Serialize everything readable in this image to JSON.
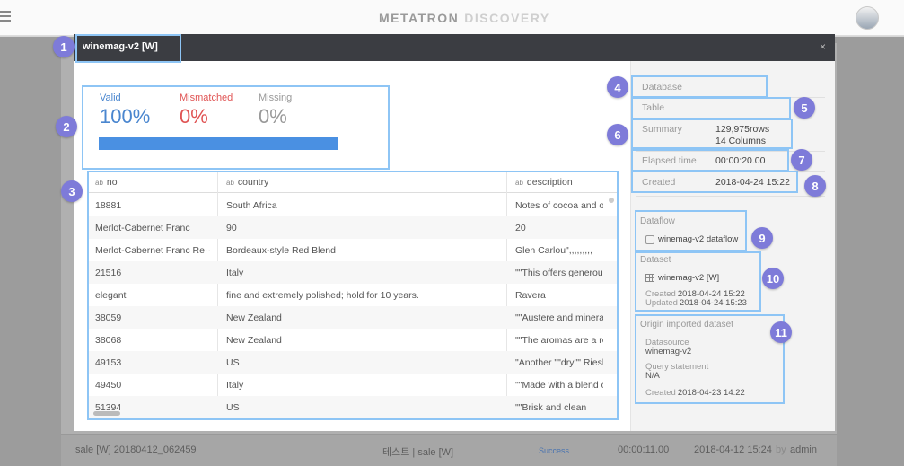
{
  "app": {
    "brand_main": "METATRON",
    "brand_sub": "DISCOVERY"
  },
  "modal": {
    "title": "winemag-v2 [W]",
    "close_label": "×"
  },
  "stats": {
    "valid_label": "Valid",
    "valid_value": "100%",
    "mismatched_label": "Mismatched",
    "mismatched_value": "0%",
    "missing_label": "Missing",
    "missing_value": "0%",
    "valid_fraction": 1.0
  },
  "table": {
    "type_tag": "ab",
    "columns": [
      "no",
      "country",
      "description"
    ],
    "rows": [
      [
        "18881",
        "South Africa",
        "Notes of cocoa and oal"
      ],
      [
        "Merlot-Cabernet Franc",
        "90",
        "20"
      ],
      [
        "Merlot-Cabernet Franc Re···",
        "Bordeaux-style Red Blend",
        "Glen Carlou\",,,,,,,,,"
      ],
      [
        "21516",
        "Italy",
        "\"\"This offers generous"
      ],
      [
        "elegant",
        "fine and extremely polished; hold for 10 years.",
        "Ravera"
      ],
      [
        "38059",
        "New Zealand",
        "\"\"Austere and minerall"
      ],
      [
        "38068",
        "New Zealand",
        "\"\"The aromas are a ref"
      ],
      [
        "49153",
        "US",
        "\"Another \"\"dry\"\" Riesli"
      ],
      [
        "49450",
        "Italy",
        "\"\"Made with a blend of"
      ],
      [
        "51394",
        "US",
        "\"\"Brisk and clean"
      ]
    ]
  },
  "side": {
    "database_label": "Database",
    "table_label": "Table",
    "summary_label": "Summary",
    "summary_rows": "129,975rows",
    "summary_cols": "14 Columns",
    "elapsed_label": "Elapsed time",
    "elapsed_value": "00:00:20.00",
    "created_label": "Created",
    "created_value": "2018-04-24 15:22",
    "dataflow_title": "Dataflow",
    "dataflow_name": "winemag-v2 dataflow",
    "dataset_title": "Dataset",
    "dataset_name": "winemag-v2 [W]",
    "dataset_created_label": "Created",
    "dataset_created_value": "2018-04-24 15:22",
    "dataset_updated_label": "Updated",
    "dataset_updated_value": "2018-04-24 15:23",
    "origin_title": "Origin imported dataset",
    "datasource_label": "Datasource",
    "datasource_value": "winemag-v2",
    "query_label": "Query statement",
    "query_value": "N/A",
    "origin_created_label": "Created",
    "origin_created_value": "2018-04-23 14:22"
  },
  "footer_row": {
    "name": "sale [W] 20180412_062459",
    "dataflow": "테스트 | sale [W]",
    "status": "Success",
    "elapsed": "00:00:11.00",
    "date": "2018-04-12 15:24",
    "by": "by",
    "user": "admin"
  },
  "badges": [
    "1",
    "2",
    "3",
    "4",
    "5",
    "6",
    "7",
    "8",
    "9",
    "10",
    "11"
  ],
  "colors": {
    "accent": "#4a90e2",
    "mismatch": "#e05454",
    "badge": "#7e7bd9",
    "highlight": "#8ec5f5"
  }
}
